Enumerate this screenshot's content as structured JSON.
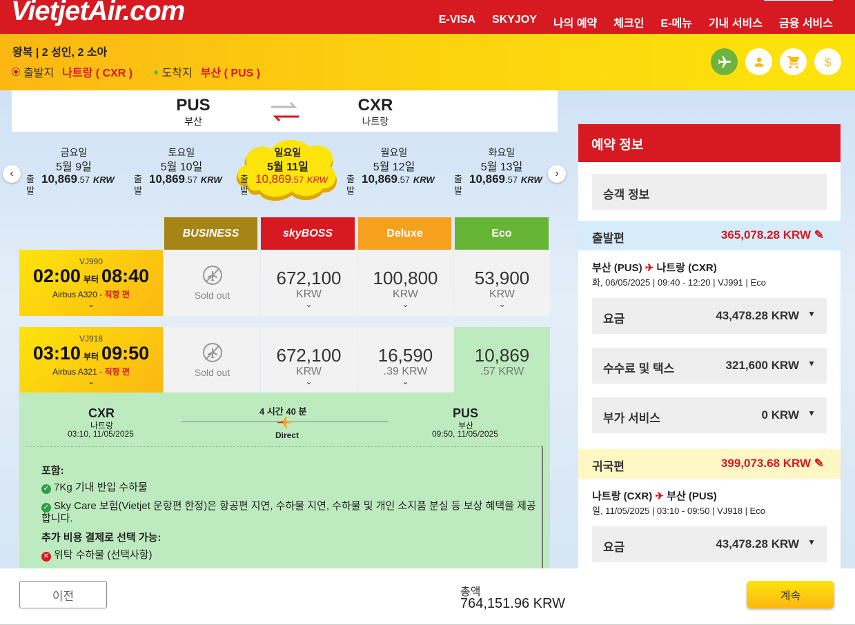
{
  "header": {
    "logo": "VietjetAir.com",
    "nav": [
      "E-VISA",
      "SKYJOY",
      "나의 예약",
      "체크인",
      "E-메뉴",
      "기내 서비스",
      "금융 서비스"
    ]
  },
  "trip": {
    "summary": "왕복 | 2 성인, 2 소아",
    "origin_label": "출발지",
    "origin_value": "나트랑 ( CXR )",
    "dest_label": "도착지",
    "dest_value": "부산 ( PUS )"
  },
  "route_card": {
    "from_code": "PUS",
    "from_name": "부산",
    "to_code": "CXR",
    "to_name": "나트랑"
  },
  "dates": [
    {
      "weekday": "금요일",
      "date": "5월 9일",
      "label": "출발",
      "price": "10,869",
      "decimal": ".57",
      "currency": "KRW",
      "active": false
    },
    {
      "weekday": "토요일",
      "date": "5월 10일",
      "label": "출발",
      "price": "10,869",
      "decimal": ".57",
      "currency": "KRW",
      "active": false
    },
    {
      "weekday": "일요일",
      "date": "5월 11일",
      "label": "출발",
      "price": "10,869",
      "decimal": ".57",
      "currency": "KRW",
      "active": true
    },
    {
      "weekday": "월요일",
      "date": "5월 12일",
      "label": "출발",
      "price": "10,869",
      "decimal": ".57",
      "currency": "KRW",
      "active": false
    },
    {
      "weekday": "화요일",
      "date": "5월 13일",
      "label": "출발",
      "price": "10,869",
      "decimal": ".57",
      "currency": "KRW",
      "active": false
    }
  ],
  "fare_classes": [
    {
      "name": "BUSINESS",
      "color": "#a68415"
    },
    {
      "name": "skyBOSS",
      "color": "#d71921"
    },
    {
      "name": "Deluxe",
      "color": "#f6a11e"
    },
    {
      "name": "Eco",
      "color": "#67b534"
    }
  ],
  "flights": [
    {
      "number": "VJ990",
      "dep": "02:00",
      "sep": "부터",
      "arr": "08:40",
      "aircraft": "Airbus A320",
      "direct": "직항 편",
      "fares": [
        {
          "sold_out": true,
          "label": "Sold out"
        },
        {
          "price": "672,100",
          "currency": "KRW"
        },
        {
          "price": "100,800",
          "currency": "KRW"
        },
        {
          "price": "53,900",
          "currency": "KRW"
        }
      ]
    },
    {
      "number": "VJ918",
      "dep": "03:10",
      "sep": "부터",
      "arr": "09:50",
      "aircraft": "Airbus A321",
      "direct": "직항 편",
      "fares": [
        {
          "sold_out": true,
          "label": "Sold out"
        },
        {
          "price": "672,100",
          "currency": "KRW"
        },
        {
          "price": "16,590",
          "currency": ".39 KRW"
        },
        {
          "price": "10,869",
          "currency": ".57 KRW",
          "selected": true
        }
      ]
    }
  ],
  "detail": {
    "from_code": "CXR",
    "from_name": "나트랑",
    "from_time": "03:10, 11/05/2025",
    "duration": "4 시간 40 분",
    "type": "Direct",
    "to_code": "PUS",
    "to_name": "부산",
    "to_time": "09:50, 11/05/2025",
    "includes_title": "포함:",
    "includes": [
      "7Kg 기내 반입 수하물",
      "Sky Care 보험(Vietjet 운항편 한정)은 항공편 지연, 수하물 지연, 수하물 및 개인 소지품 분실 등 보상 혜택을 제공합니다."
    ],
    "extra_title": "추가 비용 결제로 선택 가능:",
    "extras": [
      "위탁 수하물 (선택사항)"
    ]
  },
  "booking": {
    "title": "예약 정보",
    "passenger": "승객 정보",
    "outbound": {
      "label": "출발편",
      "total": "365,078.28 KRW",
      "route_from": "부산 (PUS)",
      "route_to": "나트랑 (CXR)",
      "info": "화, 06/05/2025 | 09:40 - 12:20 | VJ991 | Eco",
      "lines": [
        {
          "label": "요금",
          "value": "43,478.28 KRW"
        },
        {
          "label": "수수료 및 택스",
          "value": "321,600 KRW"
        },
        {
          "label": "부가 서비스",
          "value": "0 KRW"
        }
      ]
    },
    "return": {
      "label": "귀국편",
      "total": "399,073.68 KRW",
      "route_from": "나트랑 (CXR)",
      "route_to": "부산 (PUS)",
      "info": "일, 11/05/2025 | 03:10 - 09:50 | VJ918 | Eco",
      "lines": [
        {
          "label": "요금",
          "value": "43,478.28 KRW"
        }
      ]
    }
  },
  "footer": {
    "prev": "이전",
    "total_label": "총액",
    "total_value": "764,151.96 KRW",
    "next": "계속"
  },
  "colors": {
    "brand_red": "#d71921",
    "brand_yellow": "#fcb713",
    "eco_green": "#67b534",
    "selected_green": "#bdebbf"
  }
}
